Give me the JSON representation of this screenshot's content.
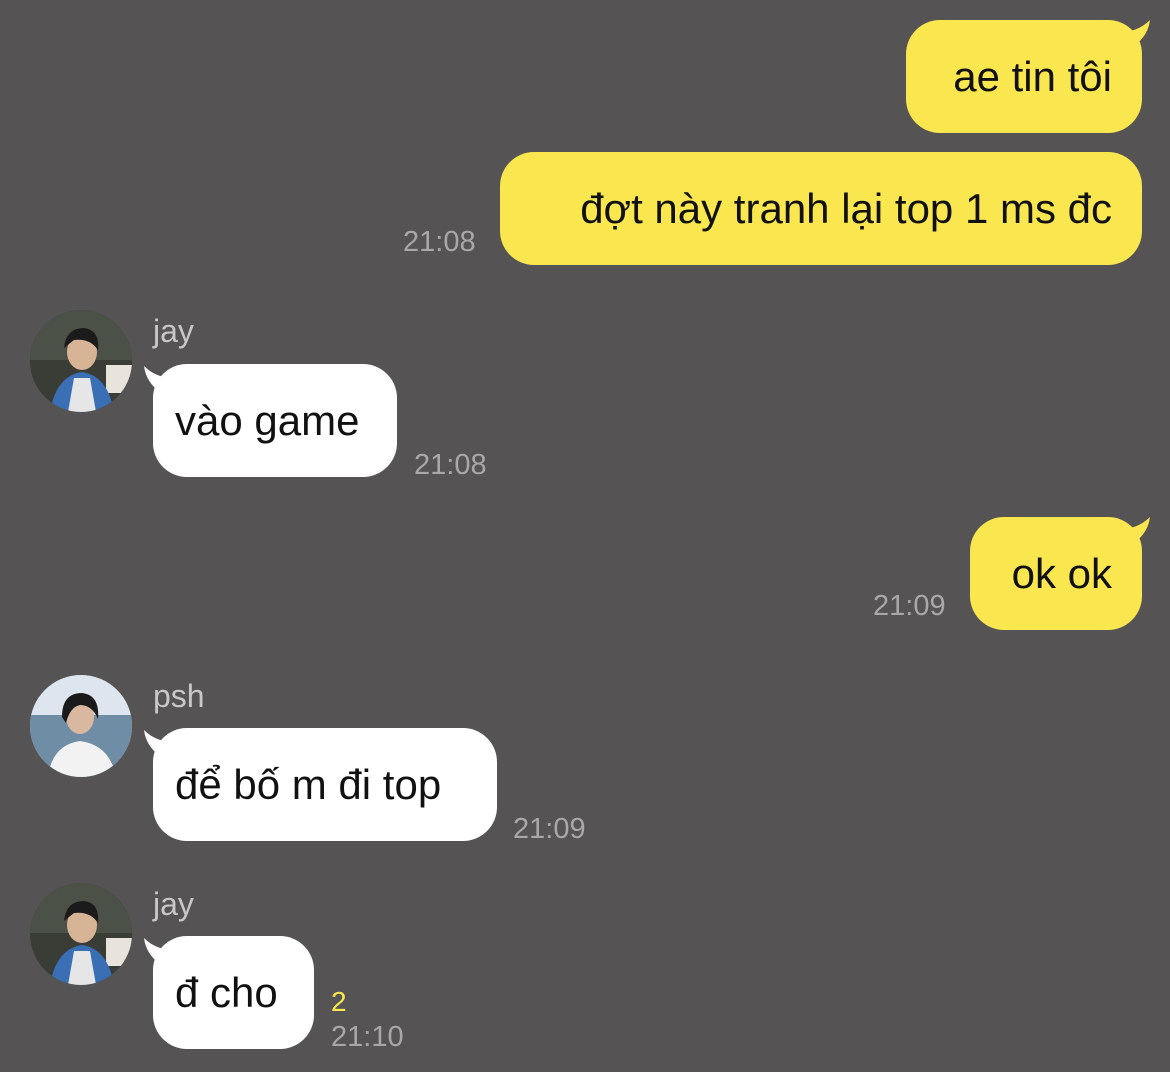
{
  "chat": {
    "messages": [
      {
        "direction": "outgoing",
        "text": "ae tin tôi"
      },
      {
        "direction": "outgoing",
        "text": "đợt này tranh lại top 1 ms đc",
        "time": "21:08"
      },
      {
        "direction": "incoming",
        "sender": "jay",
        "text": "vào game",
        "time": "21:08"
      },
      {
        "direction": "outgoing",
        "text": "ok ok",
        "time": "21:09"
      },
      {
        "direction": "incoming",
        "sender": "psh",
        "text": "để bố m đi top",
        "time": "21:09"
      },
      {
        "direction": "incoming",
        "sender": "jay",
        "text": "đ cho",
        "time": "21:10",
        "unread_count": "2"
      }
    ]
  },
  "colors": {
    "background": "#555354",
    "outgoing_bubble": "#fae64e",
    "incoming_bubble": "#ffffff",
    "timestamp": "#a9a7a8",
    "unread_count": "#fae64e",
    "sender_name": "#c9c7c8"
  }
}
